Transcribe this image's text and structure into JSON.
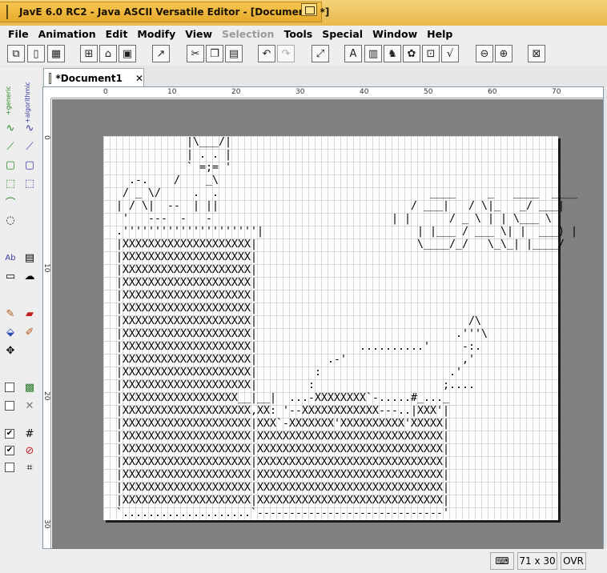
{
  "window": {
    "title": "JavE 6.0 RC2 - Java ASCII Versatile Editor - [Document1 *]"
  },
  "menu": {
    "items": [
      "File",
      "Animation",
      "Edit",
      "Modify",
      "View",
      "Selection",
      "Tools",
      "Special",
      "Window",
      "Help"
    ],
    "disabled": [
      "Selection"
    ]
  },
  "toolbar": {
    "icons": [
      "new-window-icon",
      "new-document-icon",
      "grid-document-icon",
      "open-project-icon",
      "open-icon",
      "save-icon",
      "export-icon",
      "cut-icon",
      "copy-icon",
      "paste-icon",
      "undo-icon",
      "redo-icon",
      "select-all-icon",
      "insert-text-icon",
      "palette-icon",
      "camel-icon",
      "puzzle-icon",
      "equation-icon",
      "formula-icon",
      "zoom-out-icon",
      "zoom-in-icon",
      "clear-icon"
    ]
  },
  "palette": {
    "labels": [
      "+generic",
      "+algorithmic"
    ],
    "checkbox_states": [
      false,
      false,
      true,
      true,
      false
    ]
  },
  "document": {
    "tab_title": "*Document1"
  },
  "ruler": {
    "h_labels": [
      "0",
      "10",
      "20",
      "30",
      "40",
      "50",
      "60",
      "70"
    ],
    "v_labels": [
      "0",
      "10",
      "20",
      "30"
    ]
  },
  "canvas": {
    "ascii_art": "             |\\___/|\n             | . . |\n             ` =;= '\n    .-.    /    _\\\n   / _ \\/     .  .                                 ____     _   ____  ____\n  | / \\|  --  | ||                              / ___|   / \\|_   _/ ___|\n   '   ---  -   -                            | |      / _ \\ | | \\___ \\\n  .'''''''''''''''''''''|                        | |___ / ___ \\| |  ___) |\n  |XXXXXXXXXXXXXXXXXXXX|                         \\____/_/   \\_\\_| |____/\n  |XXXXXXXXXXXXXXXXXXXX|\n  |XXXXXXXXXXXXXXXXXXXX|\n  |XXXXXXXXXXXXXXXXXXXX|\n  |XXXXXXXXXXXXXXXXXXXX|\n  |XXXXXXXXXXXXXXXXXXXX|\n  |XXXXXXXXXXXXXXXXXXXX|                                 /\\\n  |XXXXXXXXXXXXXXXXXXXX|                               .'''\\\n  |XXXXXXXXXXXXXXXXXXXX|                ..........'     -:.\n  |XXXXXXXXXXXXXXXXXXXX|           .-'                  ,'\n  |XXXXXXXXXXXXXXXXXXXX|         :                    .'\n  |XXXXXXXXXXXXXXXXXXXX|        :                    ;....\n  |XXXXXXXXXXXXXXXXXX__|__|  ...-XXXXXXXX`-.....#_..._\n  |XXXXXXXXXXXXXXXXXXXX,XX: '--XXXXXXXXXXXX---..|XXX'|\n  |XXXXXXXXXXXXXXXXXXXX|XXX`-XXXXXXX'XXXXXXXXXX'XXXXX|\n  |XXXXXXXXXXXXXXXXXXXX|XXXXXXXXXXXXXXXXXXXXXXXXXXXXX|\n  |XXXXXXXXXXXXXXXXXXXX|XXXXXXXXXXXXXXXXXXXXXXXXXXXXX|\n  |XXXXXXXXXXXXXXXXXXXX|XXXXXXXXXXXXXXXXXXXXXXXXXXXXX|\n  |XXXXXXXXXXXXXXXXXXXX|XXXXXXXXXXXXXXXXXXXXXXXXXXXXX|\n  |XXXXXXXXXXXXXXXXXXXX|XXXXXXXXXXXXXXXXXXXXXXXXXXXXX|\n  |XXXXXXXXXXXXXXXXXXXX|XXXXXXXXXXXXXXXXXXXXXXXXXXXXX|\n  `....................`-----------------------------'"
  },
  "status": {
    "size": "71 x 30",
    "mode": "OVR"
  },
  "colors": {
    "title_bar": "#f0c04a",
    "workspace": "#808080",
    "grid_line": "#d6d6d6"
  }
}
